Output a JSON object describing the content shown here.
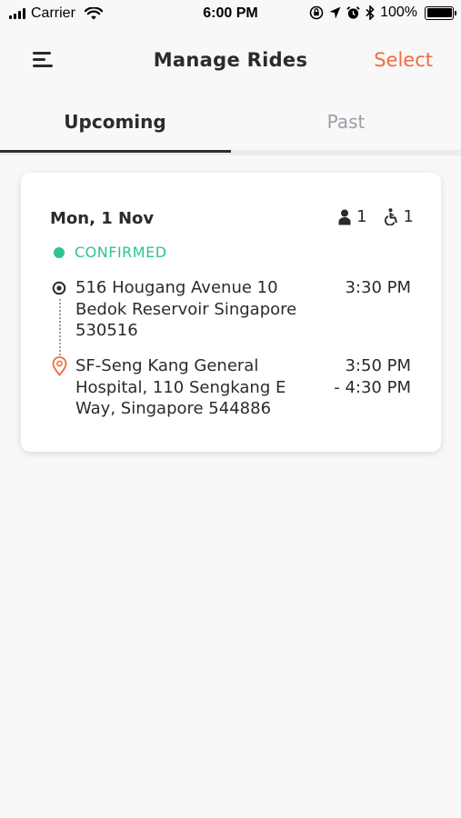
{
  "status_bar": {
    "carrier": "Carrier",
    "time": "6:00 PM",
    "battery": "100%",
    "battery_level": 1.0
  },
  "header": {
    "menu_icon": "hamburger-menu-icon",
    "title": "Manage Rides",
    "select_label": "Select",
    "accent_color": "#f06b3f"
  },
  "tabs": [
    {
      "label": "Upcoming",
      "active": true
    },
    {
      "label": "Past",
      "active": false
    }
  ],
  "rides": [
    {
      "date": "Mon, 1 Nov",
      "passengers": "1",
      "wheelchairs": "1",
      "status": "CONFIRMED",
      "status_color": "#2ec48b",
      "pickup": {
        "address": "516 Hougang Avenue 10 Bedok Reservoir Singapore 530516",
        "time": "3:30 PM"
      },
      "dropoff": {
        "address": "SF-Seng Kang General Hospital, 110 Sengkang E Way, Singapore 544886",
        "time_start": "3:50 PM",
        "time_end": "- 4:30 PM"
      }
    }
  ]
}
